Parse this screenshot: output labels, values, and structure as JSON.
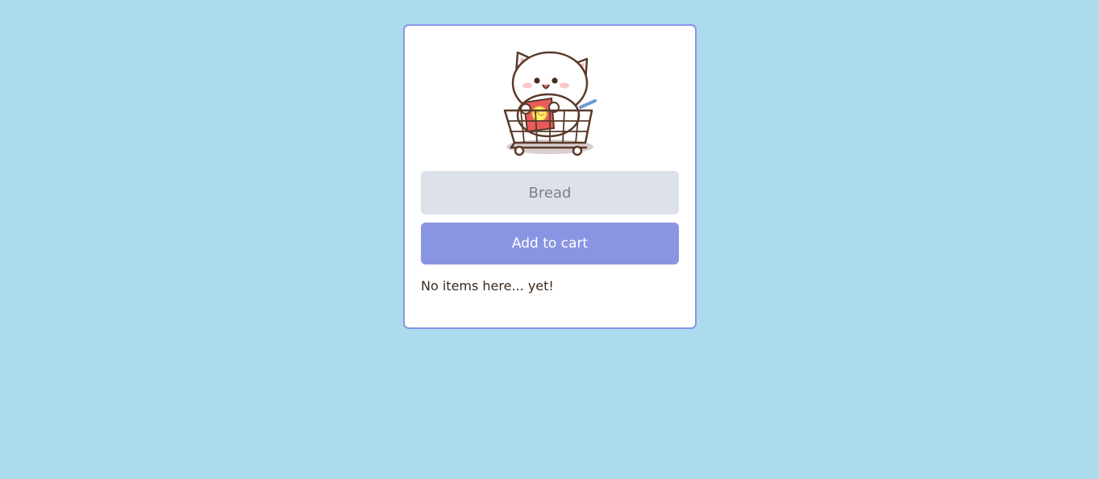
{
  "colors": {
    "page_background": "#acdbed",
    "card_border": "#8a95e6",
    "input_background": "#dce1ea",
    "button_background": "#8995e3",
    "text": "#3b2a1c"
  },
  "mascot": {
    "icon": "cat-in-shopping-cart-icon"
  },
  "form": {
    "input_placeholder": "Bread",
    "input_value": "",
    "button_label": "Add to cart"
  },
  "cart": {
    "empty_message": "No items here... yet!"
  }
}
